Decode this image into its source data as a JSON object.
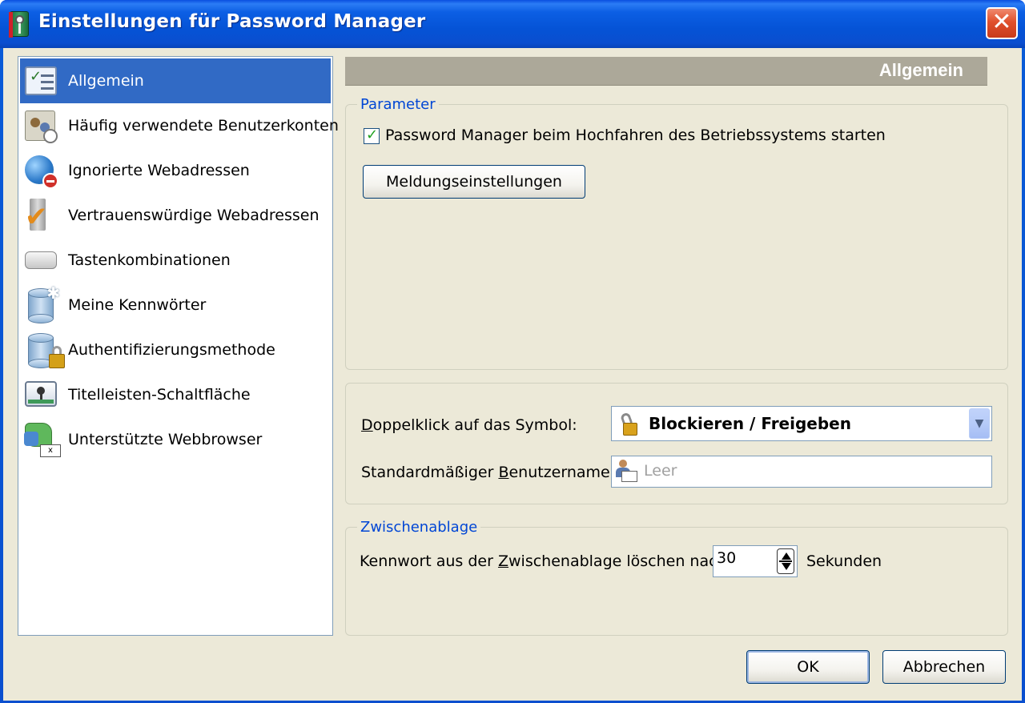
{
  "window": {
    "title": "Einstellungen für Password Manager",
    "close_glyph": "✕"
  },
  "sidebar": {
    "items": [
      {
        "label": "Allgemein",
        "icon": "checklist-icon",
        "selected": true
      },
      {
        "label": "Häufig verwendete Benutzerkonten",
        "icon": "frequent-accounts-icon"
      },
      {
        "label": "Ignorierte Webadressen",
        "icon": "blocked-globe-icon"
      },
      {
        "label": "Vertrauenswürdige Webadressen",
        "icon": "trusted-check-icon"
      },
      {
        "label": "Tastenkombinationen",
        "icon": "keyboard-key-icon"
      },
      {
        "label": "Meine Kennwörter",
        "icon": "password-database-icon"
      },
      {
        "label": "Authentifizierungsmethode",
        "icon": "locked-database-icon"
      },
      {
        "label": "Titelleisten-Schaltfläche",
        "icon": "titlebar-button-icon"
      },
      {
        "label": "Unterstützte Webbrowser",
        "icon": "browser-plugin-icon"
      }
    ]
  },
  "main": {
    "header": "Allgemein",
    "parameter_group": {
      "legend": "Parameter",
      "autostart_label": "Password Manager beim Hochfahren des Betriebssystems starten",
      "autostart_checked": true,
      "notify_button": "Meldungseinstellungen"
    },
    "behavior_group": {
      "doubleclick_label_u": "D",
      "doubleclick_label_rest": "oppelklick auf das Symbol:",
      "doubleclick_value": "Blockieren / Freigeben",
      "default_user_label_pre": "Standardmäßiger ",
      "default_user_label_u": "B",
      "default_user_label_rest": "enutzername:",
      "default_user_placeholder": "Leer"
    },
    "clipboard_group": {
      "legend": "Zwischenablage",
      "label_pre": "Kennwort aus der ",
      "label_u": "Z",
      "label_rest": "wischenablage löschen nach",
      "seconds_value": "30",
      "unit": "Sekunden"
    }
  },
  "footer": {
    "ok": "OK",
    "cancel": "Abbrechen"
  },
  "colors": {
    "titlebar": "#0a54d8",
    "selection": "#316ac5",
    "dialog_bg": "#ece9d8",
    "group_legend": "#0046d5",
    "header_bar": "#aca899"
  }
}
